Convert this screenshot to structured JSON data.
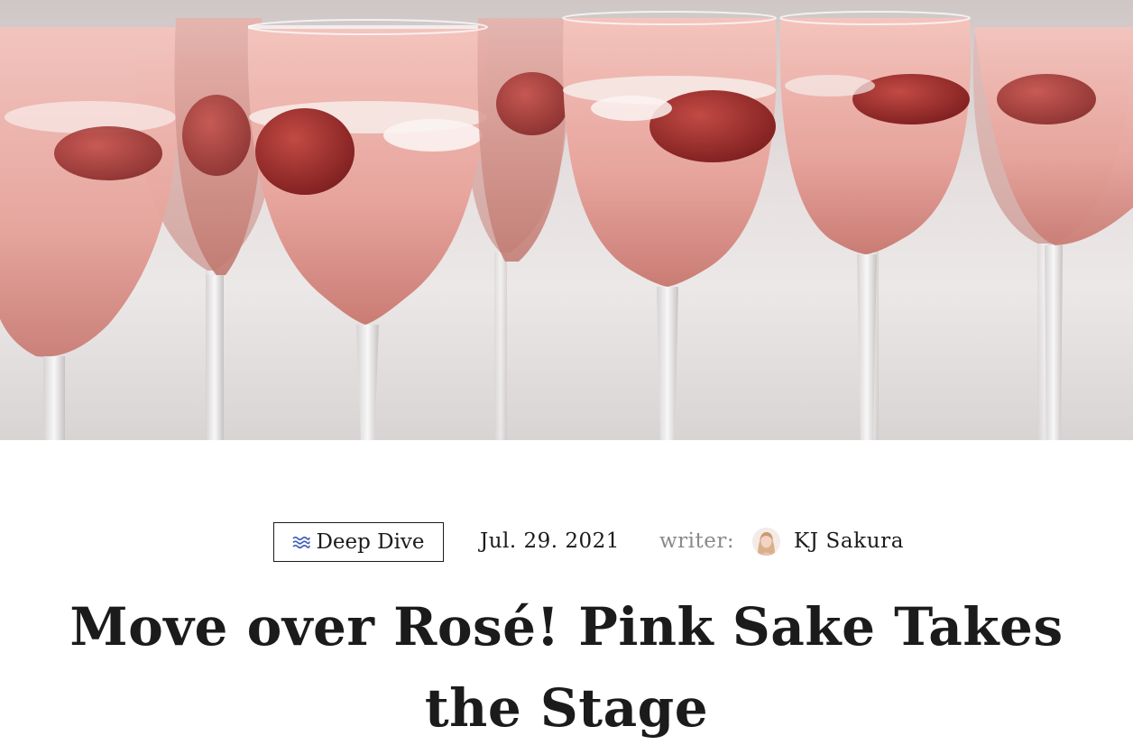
{
  "hero": {
    "image_icon": "pink-sake-glasses-photo",
    "accent_wine": "#e9a9a3",
    "accent_strawberry": "#a8322e"
  },
  "meta": {
    "category_icon": "waves-icon",
    "category": "Deep Dive",
    "date": "Jul. 29. 2021",
    "writer_label": "writer:",
    "author": "KJ Sakura",
    "category_color": "#3d5db6"
  },
  "article": {
    "title": "Move over Rosé! Pink Sake Takes the Stage"
  }
}
